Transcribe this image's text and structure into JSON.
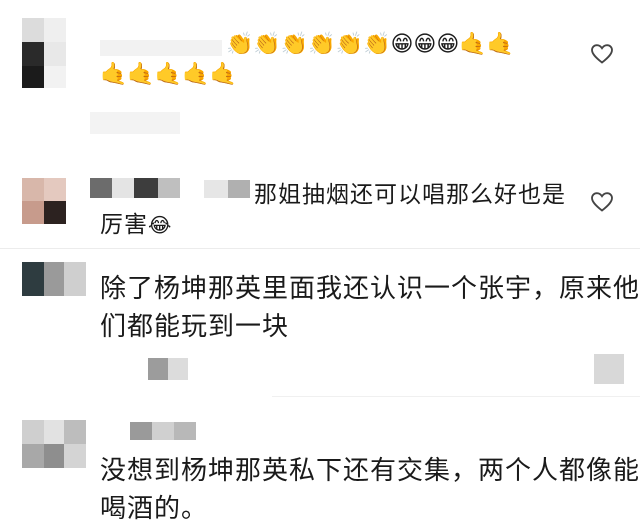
{
  "comments": [
    {
      "text_lines": [],
      "emoji_row1": [
        "👏",
        "👏",
        "👏",
        "👏",
        "👏",
        "👏",
        "😁",
        "😁",
        "😁",
        "🤙",
        "🤙"
      ],
      "emoji_row2": [
        "🤙",
        "🤙",
        "🤙",
        "🤙",
        "🤙"
      ]
    },
    {
      "text_lines": [
        "那姐抽烟还可以唱那么好也是",
        "厉害"
      ],
      "trailing_emoji": "😂"
    },
    {
      "text_lines": [
        "除了杨坤那英里面我还认识一个张宇，原来他",
        "们都能玩到一块"
      ]
    },
    {
      "text_lines": [
        "没想到杨坤那英私下还有交集，两个人都像能",
        "喝酒的。"
      ]
    }
  ],
  "icons": {
    "like": "heart-outline-icon"
  }
}
